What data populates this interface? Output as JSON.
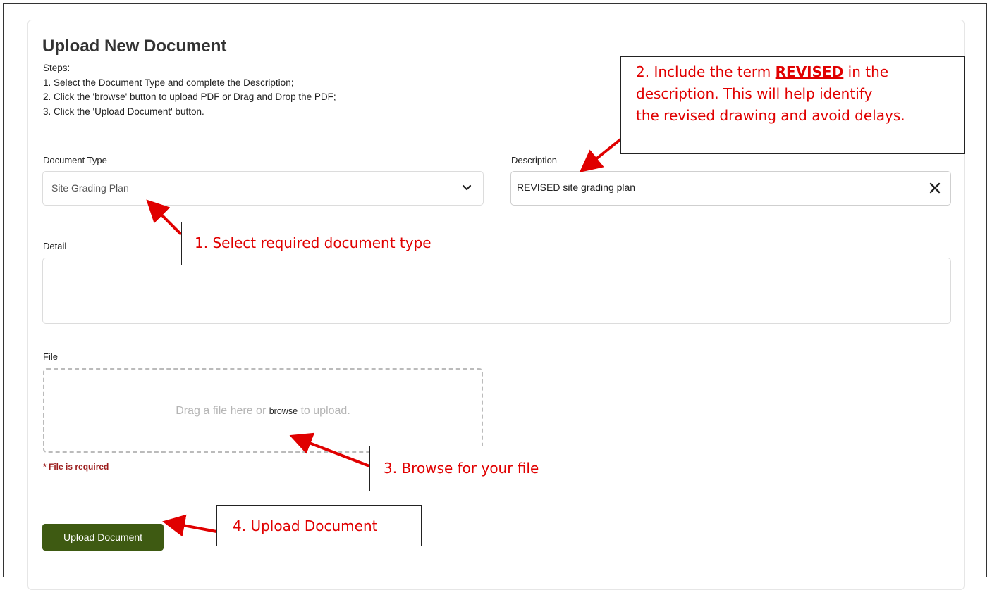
{
  "form": {
    "title": "Upload New Document",
    "steps_heading": "Steps:",
    "steps": [
      "1. Select the Document Type and complete the Description;",
      "2. Click the 'browse' button to upload PDF or Drag and Drop the PDF;",
      "3. Click the 'Upload Document' button."
    ],
    "document_type_label": "Document Type",
    "document_type_value": "Site Grading Plan",
    "description_label": "Description",
    "description_value": "REVISED site grading plan",
    "detail_label": "Detail",
    "detail_value": "",
    "file_label": "File",
    "dropzone_prefix": "Drag a file here or ",
    "dropzone_browse": "browse",
    "dropzone_suffix": " to upload.",
    "file_required": "* File is required",
    "upload_button": "Upload Document",
    "button_color": "#3e5a12"
  },
  "annotations": {
    "callout1": "1.  Select required document type",
    "callout2_prefix": "2. Include the term ",
    "callout2_strong": "REVISED",
    "callout2_suffix": " in the",
    "callout2_line2": "description.  This will help identify",
    "callout2_line3": "the revised drawing and avoid delays.",
    "callout3": "3. Browse for your file",
    "callout4": "4. Upload Document",
    "color": "#e00000"
  }
}
